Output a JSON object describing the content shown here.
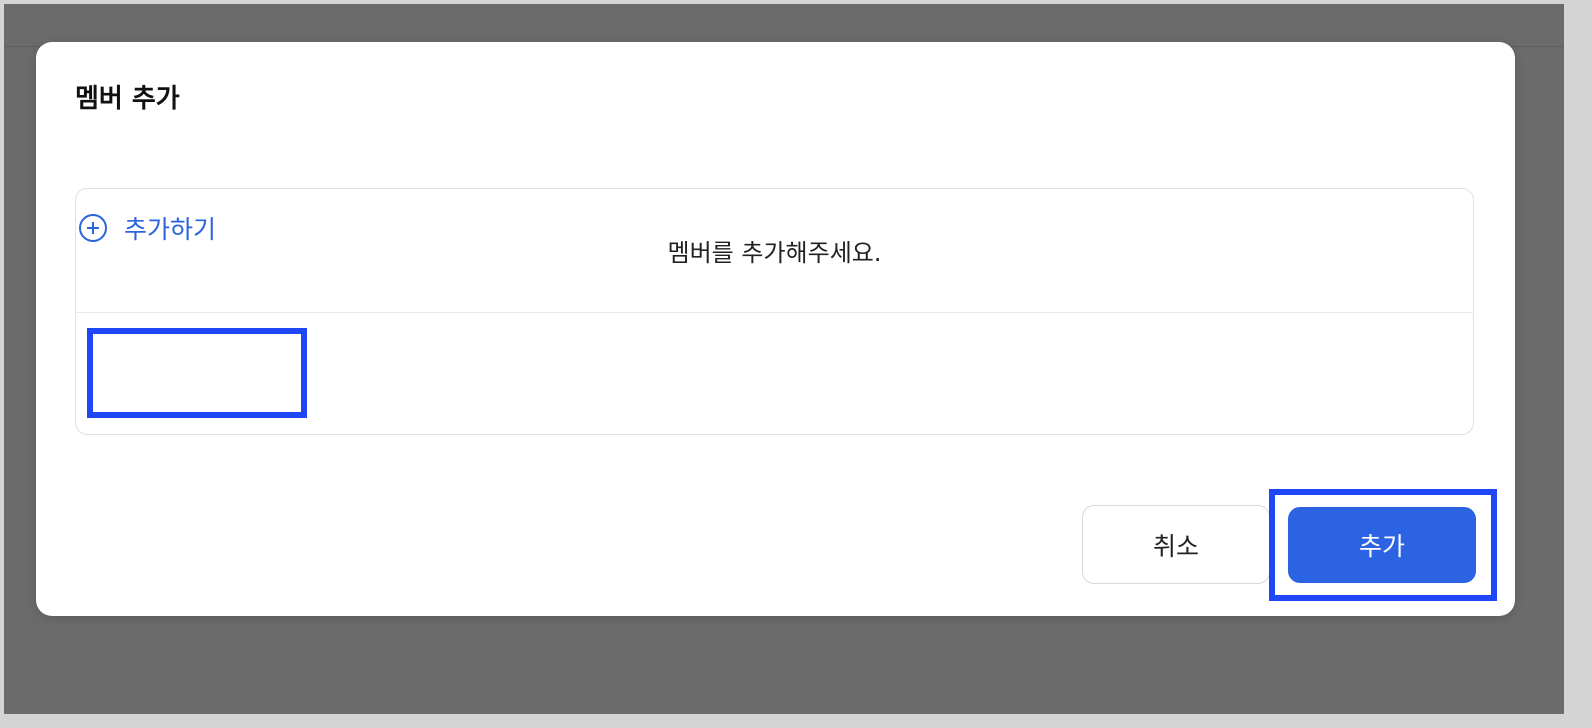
{
  "modal": {
    "title": "멤버 추가",
    "empty_message": "멤버를 추가해주세요.",
    "add_member_label": "추가하기",
    "add_member_icon": "plus-circle-icon",
    "cancel_label": "취소",
    "submit_label": "추가"
  },
  "colors": {
    "accent": "#2b63e3",
    "highlight": "#1f47f5",
    "overlay": "#6b6b6b"
  }
}
